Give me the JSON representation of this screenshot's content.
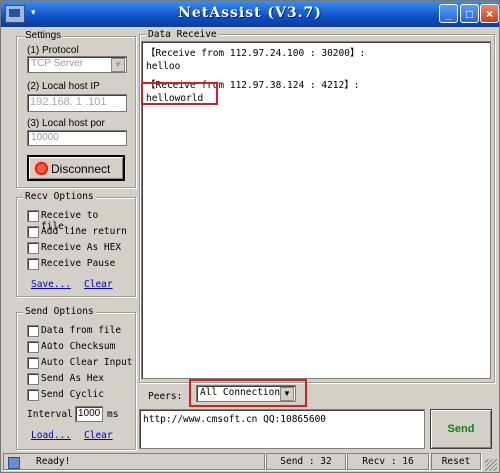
{
  "window": {
    "title": "NetAssist (V3.7)",
    "sysmenu_glyph": "▾",
    "minimize_glyph": "_",
    "maximize_glyph": "□",
    "close_glyph": "×"
  },
  "settings": {
    "group_label": "Settings",
    "protocol_label": "(1) Protocol",
    "protocol_value": "TCP Server",
    "localhost_ip_label": "(2) Local host IP",
    "ip_octets": [
      "192",
      "168",
      "1",
      "101"
    ],
    "port_label": "(3) Local host por",
    "port_value": "10000",
    "disconnect_label": "Disconnect"
  },
  "recv_options": {
    "group_label": "Recv Options",
    "items": [
      "Receive to file...",
      "Add line return",
      "Receive As HEX",
      "Receive Pause"
    ],
    "save_link": "Save...",
    "clear_link": "Clear"
  },
  "send_options": {
    "group_label": "Send Options",
    "items": [
      "Data from file ...",
      "Auto Checksum",
      "Auto Clear Input",
      "Send As Hex",
      "Send Cyclic"
    ],
    "interval_label": "Interval",
    "interval_value": "1000",
    "interval_unit": "ms",
    "load_link": "Load...",
    "clear_link": "Clear"
  },
  "data_receive": {
    "group_label": "Data Receive",
    "lines": [
      "【Receive from 112.97.24.100 : 30200】:",
      "helloo",
      "【Receive from 112.97.38.124 : 4212】:",
      "helloworld"
    ]
  },
  "peers": {
    "label": "Peers:",
    "value": "All Connections"
  },
  "send_area": {
    "text": "http://www.cmsoft.cn QQ:10865600",
    "send_label": "Send"
  },
  "statusbar": {
    "ready": "Ready!",
    "send_count": "Send : 32",
    "recv_count": "Recv : 16",
    "reset_label": "Reset"
  },
  "colors": {
    "title_bar": "#0e4fc4",
    "face": "#d4d0c8",
    "highlight_box": "#d62020",
    "send_button_text": "#1a7a1a",
    "link": "#0000cc"
  }
}
